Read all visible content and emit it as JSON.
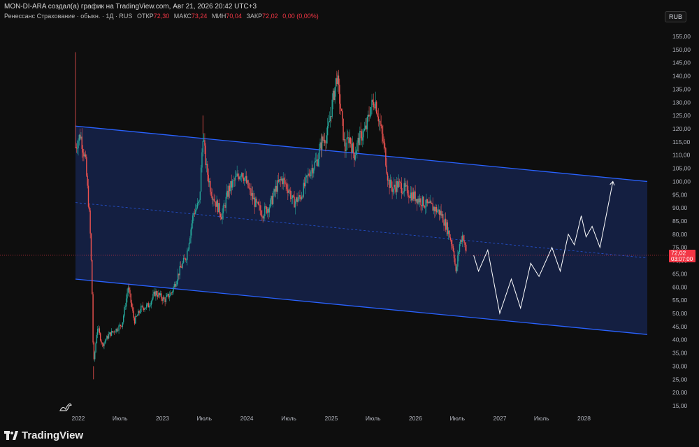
{
  "header": {
    "title": "MON-DI-ARA создал(а) график на TradingView.com, Авг 21, 2026 20:42 UTC+3"
  },
  "symbol": {
    "name": "Ренессанс Страхование · обыкн. · 1Д · RUS",
    "open_label": "ОТКР",
    "open": "72,30",
    "high_label": "МАКС",
    "high": "73,24",
    "low_label": "МИН",
    "low": "70,04",
    "close_label": "ЗАКР",
    "close": "72,02",
    "change": "0,00 (0,00%)"
  },
  "currency": "RUB",
  "last_price": {
    "value": "72,02",
    "countdown": "03:07:00",
    "color": "#f23645"
  },
  "brand": "TradingView",
  "colors": {
    "channel_fill": "#15224a",
    "channel_line": "#2962ff",
    "up": "#26a69a",
    "down": "#ef5350",
    "projection": "#ffffff"
  },
  "chart_data": {
    "type": "candlestick",
    "ylim": [
      15,
      157
    ],
    "y_ticks": [
      "155,00",
      "150,00",
      "145,00",
      "140,00",
      "135,00",
      "130,00",
      "125,00",
      "120,00",
      "115,00",
      "110,00",
      "105,00",
      "100,00",
      "95,00",
      "90,00",
      "85,00",
      "80,00",
      "75,00",
      "70,00",
      "65,00",
      "60,00",
      "55,00",
      "50,00",
      "45,00",
      "40,00",
      "35,00",
      "30,00",
      "25,00",
      "20,00",
      "15,00"
    ],
    "x_ticks": [
      "2022",
      "Июль",
      "2023",
      "Июль",
      "2024",
      "Июль",
      "2025",
      "Июль",
      "2026",
      "Июль",
      "2027",
      "Июль",
      "2028"
    ],
    "x_tick_dates": [
      "2022-01-01",
      "2022-07-01",
      "2023-01-01",
      "2023-07-01",
      "2024-01-01",
      "2024-07-01",
      "2025-01-01",
      "2025-07-01",
      "2026-01-01",
      "2026-07-01",
      "2027-01-01",
      "2027-07-01",
      "2028-01-01"
    ],
    "price_path": [
      [
        "2021-12-20",
        113
      ],
      [
        "2022-01-10",
        118
      ],
      [
        "2022-02-01",
        108
      ],
      [
        "2022-02-20",
        85
      ],
      [
        "2022-03-01",
        62
      ],
      [
        "2022-03-08",
        30
      ],
      [
        "2022-03-25",
        45
      ],
      [
        "2022-04-15",
        38
      ],
      [
        "2022-05-15",
        42
      ],
      [
        "2022-06-15",
        44
      ],
      [
        "2022-07-10",
        46
      ],
      [
        "2022-08-05",
        60
      ],
      [
        "2022-09-01",
        47
      ],
      [
        "2022-10-01",
        52
      ],
      [
        "2022-11-01",
        53
      ],
      [
        "2022-12-01",
        58
      ],
      [
        "2023-01-10",
        55
      ],
      [
        "2023-02-10",
        58
      ],
      [
        "2023-03-15",
        66
      ],
      [
        "2023-04-15",
        72
      ],
      [
        "2023-05-15",
        88
      ],
      [
        "2023-06-10",
        92
      ],
      [
        "2023-06-25",
        118
      ],
      [
        "2023-07-10",
        105
      ],
      [
        "2023-08-01",
        96
      ],
      [
        "2023-08-20",
        92
      ],
      [
        "2023-09-15",
        87
      ],
      [
        "2023-10-15",
        97
      ],
      [
        "2023-11-15",
        101
      ],
      [
        "2023-12-10",
        104
      ],
      [
        "2024-01-10",
        97
      ],
      [
        "2024-02-10",
        91
      ],
      [
        "2024-03-10",
        88
      ],
      [
        "2024-04-10",
        91
      ],
      [
        "2024-05-10",
        98
      ],
      [
        "2024-06-01",
        101
      ],
      [
        "2024-07-01",
        97
      ],
      [
        "2024-07-20",
        92
      ],
      [
        "2024-08-20",
        94
      ],
      [
        "2024-10-01",
        104
      ],
      [
        "2024-11-01",
        108
      ],
      [
        "2024-11-20",
        115
      ],
      [
        "2024-12-15",
        118
      ],
      [
        "2025-01-10",
        132
      ],
      [
        "2025-01-25",
        140
      ],
      [
        "2025-02-10",
        128
      ],
      [
        "2025-03-01",
        112
      ],
      [
        "2025-03-20",
        117
      ],
      [
        "2025-04-10",
        110
      ],
      [
        "2025-05-01",
        116
      ],
      [
        "2025-06-01",
        120
      ],
      [
        "2025-06-20",
        128
      ],
      [
        "2025-07-10",
        131
      ],
      [
        "2025-07-30",
        122
      ],
      [
        "2025-08-20",
        112
      ],
      [
        "2025-09-05",
        100
      ],
      [
        "2025-09-25",
        97
      ],
      [
        "2025-10-15",
        99
      ],
      [
        "2025-11-15",
        97
      ],
      [
        "2025-12-15",
        95
      ],
      [
        "2026-01-20",
        93
      ],
      [
        "2026-02-20",
        91
      ],
      [
        "2026-03-20",
        90
      ],
      [
        "2026-04-20",
        88
      ],
      [
        "2026-05-20",
        82
      ],
      [
        "2026-06-15",
        74
      ],
      [
        "2026-06-25",
        65
      ],
      [
        "2026-07-10",
        76
      ],
      [
        "2026-07-25",
        80
      ],
      [
        "2026-08-10",
        72
      ]
    ],
    "spikes": [
      [
        "2021-12-20",
        149
      ],
      [
        "2022-03-08",
        25
      ],
      [
        "2023-06-25",
        125
      ],
      [
        "2025-01-25",
        141
      ]
    ],
    "channel": {
      "upper": [
        [
          "2021-12-20",
          121
        ],
        [
          "2028-10-01",
          100
        ]
      ],
      "lower": [
        [
          "2021-12-20",
          63
        ],
        [
          "2028-10-01",
          42
        ]
      ],
      "mid": [
        [
          "2021-12-20",
          92
        ],
        [
          "2028-10-01",
          71
        ]
      ]
    },
    "projection": [
      [
        "2026-09-10",
        72
      ],
      [
        "2026-10-01",
        66
      ],
      [
        "2026-11-10",
        74
      ],
      [
        "2027-01-01",
        50
      ],
      [
        "2027-02-20",
        63
      ],
      [
        "2027-04-01",
        52
      ],
      [
        "2027-05-15",
        69
      ],
      [
        "2027-06-20",
        64
      ],
      [
        "2027-08-15",
        75
      ],
      [
        "2027-09-20",
        66
      ],
      [
        "2027-10-25",
        80
      ],
      [
        "2027-11-20",
        76
      ],
      [
        "2027-12-20",
        87
      ],
      [
        "2028-01-10",
        79
      ],
      [
        "2028-02-05",
        83
      ],
      [
        "2028-03-10",
        75
      ],
      [
        "2028-05-05",
        100
      ]
    ]
  }
}
